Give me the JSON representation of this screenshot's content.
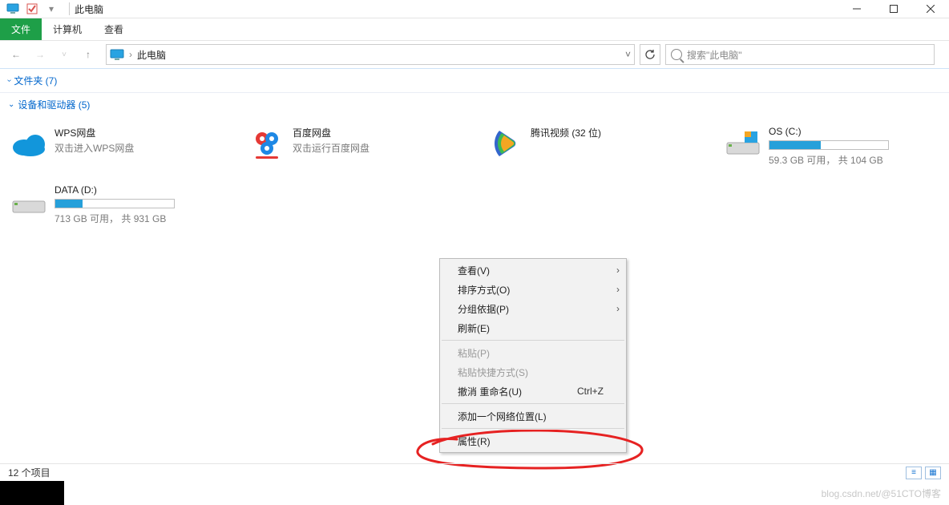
{
  "titlebar": {
    "title": "此电脑"
  },
  "ribbon": {
    "file": "文件",
    "computer": "计算机",
    "view": "查看"
  },
  "nav": {
    "crumb": "此电脑",
    "sep": "›",
    "search_placeholder": "搜索\"此电脑\""
  },
  "group_folders": {
    "label": "文件夹 (7)"
  },
  "group_devices": {
    "label": "设备和驱动器 (5)"
  },
  "items": {
    "wps": {
      "name": "WPS网盘",
      "sub": "双击进入WPS网盘"
    },
    "baidu": {
      "name": "百度网盘",
      "sub": "双击运行百度网盘"
    },
    "tencent": {
      "name": "腾讯视频 (32 位)"
    },
    "osc": {
      "name": "OS (C:)",
      "sub": "59.3 GB 可用， 共 104 GB",
      "used_pct": 43
    },
    "datad": {
      "name": "DATA (D:)",
      "sub": "713 GB 可用， 共 931 GB",
      "used_pct": 23
    }
  },
  "ctx": {
    "view": "查看(V)",
    "sort": "排序方式(O)",
    "group": "分组依据(P)",
    "refresh": "刷新(E)",
    "paste": "粘贴(P)",
    "paste_shortcut": "粘贴快捷方式(S)",
    "undo_rename": "撤消 重命名(U)",
    "undo_hot": "Ctrl+Z",
    "add_netloc": "添加一个网络位置(L)",
    "properties": "属性(R)"
  },
  "status": {
    "count": "12 个项目"
  },
  "watermark": "blog.csdn.net/@51CTO博客"
}
